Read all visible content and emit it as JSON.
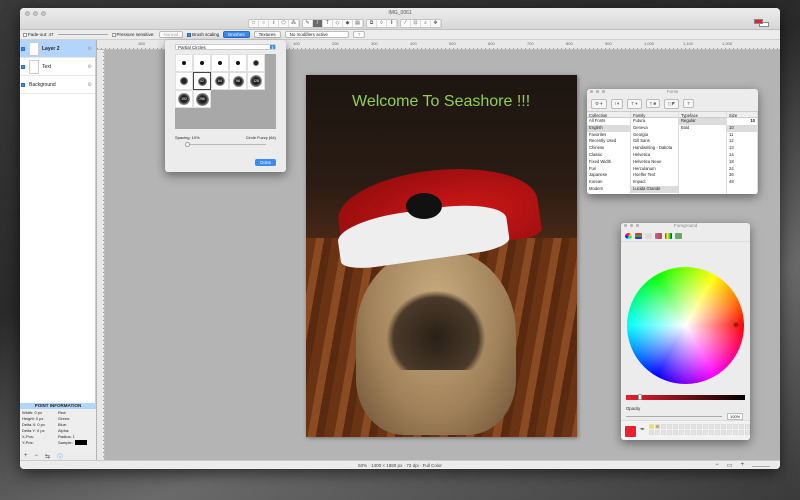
{
  "window": {
    "title": "IMG_0061"
  },
  "toolbar": {
    "tools": [
      "rect-select",
      "ellipse-select",
      "lasso",
      "polygon-lasso",
      "magic-wand",
      "pencil",
      "brush",
      "text",
      "eraser",
      "bucket",
      "gradient",
      "clone",
      "smudge",
      "effect",
      "eyedropper",
      "crop",
      "zoom",
      "position"
    ],
    "selected_tool": "brush",
    "foreground_color": "#e8202f",
    "background_color": "#ffffff"
  },
  "options": {
    "fade_out_label": "Fade-out: 47",
    "pressure_label": "Pressure sensitive:",
    "pressure_mode": "Normal",
    "brush_scaling_label": "Brush scaling",
    "brushes_tab": "Brushes",
    "textures_tab": "Textures",
    "modifiers": "No modifiers active",
    "help": "?"
  },
  "layers": [
    {
      "name": "Layer 2",
      "selected": true,
      "visible": true
    },
    {
      "name": "Text",
      "selected": false,
      "visible": true
    },
    {
      "name": "Background",
      "selected": false,
      "visible": true
    }
  ],
  "point_info": {
    "header": "POINT INFORMATION",
    "rows": [
      [
        "Width: 0 px",
        "Red:"
      ],
      [
        "Height: 0 px",
        "Green:"
      ],
      [
        "Delta X: 0 px",
        "Blue:"
      ],
      [
        "Delta Y: 0 px",
        "Alpha:"
      ],
      [
        "X-Pos:",
        "Radius: 1"
      ],
      [
        "Y-Pos:",
        "Sample:"
      ]
    ]
  },
  "layer_buttons": [
    "+",
    "−",
    "⇆",
    "ⓘ"
  ],
  "ruler": {
    "labels": [
      "-300",
      "-200",
      "-100",
      "0",
      "100",
      "200",
      "300",
      "400",
      "500",
      "600",
      "700",
      "800",
      "900",
      "1,000",
      "1,100",
      "1,200"
    ]
  },
  "canvas": {
    "text": "Welcome To Seashore !!!",
    "text_color": "#8fd24a"
  },
  "brushes_panel": {
    "group": "Partial Circles",
    "brushes": [
      "",
      "",
      "",
      "",
      "",
      "",
      "42",
      "64",
      "96",
      "128",
      "192",
      "256"
    ],
    "spacing": "Spacing: 10%",
    "brush_name": "Circle Fuzzy (64)",
    "spacing_value": 10,
    "done": "Done"
  },
  "fonts_panel": {
    "title": "Fonts",
    "headers": [
      "Collection",
      "Family",
      "Typeface",
      "Size"
    ],
    "collections": [
      "All Fonts",
      "English",
      "Favorites",
      "Recently Used",
      "Chinese",
      "Classic",
      "Fixed Width",
      "Fun",
      "Japanese",
      "Korean",
      "Modern"
    ],
    "families": [
      "Futura",
      "Geneva",
      "Georgia",
      "Gill Sans",
      "Handwriting - Dakota",
      "Helvetica",
      "Helvetica Neue",
      "Herculanum",
      "Hoefler Text",
      "Impact",
      "Lucida Grande"
    ],
    "typefaces": [
      "Regular",
      "Bold"
    ],
    "size_value": "10",
    "sizes": [
      "10",
      "11",
      "12",
      "13",
      "14",
      "18",
      "24",
      "36",
      "48"
    ]
  },
  "color_panel": {
    "title": "Foreground",
    "opacity_label": "Opacity",
    "opacity_value": "100%",
    "current_color": "#e8202f"
  },
  "status": {
    "text": "50% · 1400 × 1880 px · 72 dpi · Full Color",
    "zoom_out": "−",
    "zoom_fit": "▭",
    "zoom_in": "+"
  }
}
